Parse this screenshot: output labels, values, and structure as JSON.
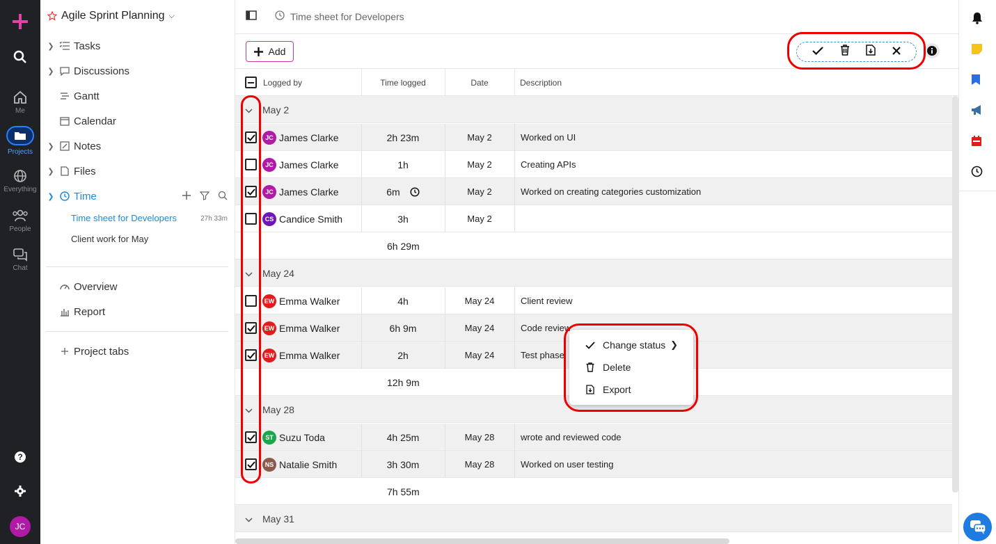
{
  "rail": {
    "items": [
      {
        "label": "Me"
      },
      {
        "label": "Projects"
      },
      {
        "label": "Everything"
      },
      {
        "label": "People"
      },
      {
        "label": "Chat"
      }
    ],
    "user_initials": "JC"
  },
  "sidebar": {
    "project_title": "Agile Sprint Planning",
    "nav": [
      "Tasks",
      "Discussions",
      "Gantt",
      "Calendar",
      "Notes",
      "Files",
      "Time"
    ],
    "time_subitems": [
      {
        "label": "Time sheet for Developers",
        "duration": "27h 33m"
      },
      {
        "label": "Client work for May"
      }
    ],
    "extra": [
      "Overview",
      "Report"
    ],
    "project_tabs": "Project tabs"
  },
  "header": {
    "title": "Time sheet for Developers"
  },
  "toolbar": {
    "add_label": "Add"
  },
  "table": {
    "columns": [
      "Logged by",
      "Time logged",
      "Date",
      "Description"
    ],
    "groups": [
      {
        "label": "May 2",
        "total": "6h 29m",
        "rows": [
          {
            "initials": "JC",
            "color": "#b01aa7",
            "name": "James Clarke",
            "time": "2h 23m",
            "date": "May 2",
            "desc": "Worked on UI",
            "checked": true
          },
          {
            "initials": "JC",
            "color": "#b01aa7",
            "name": "James Clarke",
            "time": "1h",
            "date": "May 2",
            "desc": "Creating APIs",
            "checked": false
          },
          {
            "initials": "JC",
            "color": "#b01aa7",
            "name": "James Clarke",
            "time": "6m",
            "date": "May 2",
            "desc": "Worked on creating categories customization",
            "checked": true,
            "timer": true
          },
          {
            "initials": "CS",
            "color": "#6e16b8",
            "name": "Candice Smith",
            "time": "3h",
            "date": "May 2",
            "desc": "",
            "checked": false
          }
        ]
      },
      {
        "label": "May 24",
        "total": "12h 9m",
        "rows": [
          {
            "initials": "EW",
            "color": "#e31b1b",
            "name": "Emma Walker",
            "time": "4h",
            "date": "May 24",
            "desc": "Client review",
            "checked": false
          },
          {
            "initials": "EW",
            "color": "#e31b1b",
            "name": "Emma Walker",
            "time": "6h 9m",
            "date": "May 24",
            "desc": "Code review",
            "checked": true
          },
          {
            "initials": "EW",
            "color": "#e31b1b",
            "name": "Emma Walker",
            "time": "2h",
            "date": "May 24",
            "desc": "Test phase",
            "checked": true
          }
        ]
      },
      {
        "label": "May 28",
        "total": "7h 55m",
        "rows": [
          {
            "initials": "ST",
            "color": "#1aa64a",
            "name": "Suzu Toda",
            "time": "4h 25m",
            "date": "May 28",
            "desc": "wrote and reviewed code",
            "checked": true
          },
          {
            "initials": "NS",
            "color": "#8a5a4a",
            "name": "Natalie Smith",
            "time": "3h 30m",
            "date": "May 28",
            "desc": "Worked on user testing",
            "checked": true
          }
        ]
      },
      {
        "label": "May 31"
      }
    ]
  },
  "context_menu": {
    "items": [
      "Change status",
      "Delete",
      "Export"
    ]
  },
  "colors": {
    "accent": "#1b8ae0",
    "highlight": "#e00000",
    "brand": "#d1349f"
  }
}
